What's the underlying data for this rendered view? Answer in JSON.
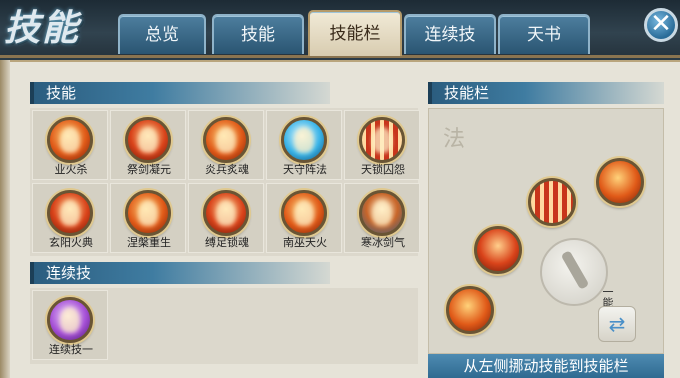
{
  "header": {
    "title": "技能",
    "tabs": [
      {
        "label": "总览",
        "active": false
      },
      {
        "label": "技能",
        "active": false
      },
      {
        "label": "技能栏",
        "active": true
      },
      {
        "label": "连续技",
        "active": false
      },
      {
        "label": "天书",
        "active": false
      }
    ],
    "close_glyph": "✕"
  },
  "skills_section": {
    "title": "技能",
    "skills": [
      {
        "name": "业火杀",
        "icon": "fire-slash-icon"
      },
      {
        "name": "祭剑凝元",
        "icon": "sword-rite-icon"
      },
      {
        "name": "炎兵炙魂",
        "icon": "flame-weapon-icon"
      },
      {
        "name": "天守阵法",
        "icon": "water-formation-icon"
      },
      {
        "name": "天锁囚怨",
        "icon": "chain-lock-icon"
      },
      {
        "name": "玄阳火典",
        "icon": "sun-fire-icon"
      },
      {
        "name": "涅槃重生",
        "icon": "rebirth-icon"
      },
      {
        "name": "缚足锁魂",
        "icon": "bind-soul-icon"
      },
      {
        "name": "南巫天火",
        "icon": "sky-fire-icon"
      },
      {
        "name": "寒冰剑气",
        "icon": "ice-sword-icon"
      }
    ]
  },
  "combo_section": {
    "title": "连续技",
    "items": [
      {
        "name": "连续技一",
        "icon": "combo-crystal-icon"
      }
    ]
  },
  "skillbar_section": {
    "title": "技能栏",
    "watermark": "法",
    "switch_label": "一能栏技",
    "switch_glyph": "⇄",
    "hint": "从左侧挪动技能到技能栏"
  },
  "colors": {
    "header_bg": "#2b3b46",
    "tab_blue": "#2a5572",
    "tab_active": "#f1ead7",
    "panel_bg": "#e6e3d8",
    "section_blue": "#2b5d7f"
  }
}
